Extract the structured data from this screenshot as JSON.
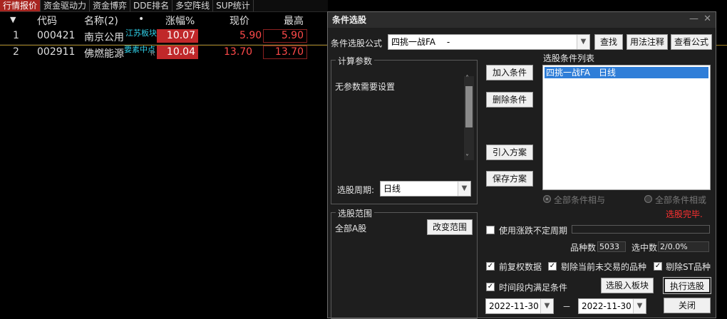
{
  "tabs": [
    "行情报价",
    "资金驱动力",
    "资金博弈",
    "DDE排名",
    "多空阵线",
    "SUP统计"
  ],
  "table": {
    "sort_arrow": "▼",
    "headers": [
      "代码",
      "名称(2)",
      "•",
      "涨幅%",
      "现价",
      "最高"
    ],
    "rows": [
      {
        "num": "1",
        "code": "000421",
        "name": "南京公用",
        "tag": "江苏板块",
        "flag": "",
        "change": "10.07",
        "price": "5.90",
        "high": "5.90"
      },
      {
        "num": "2",
        "code": "002911",
        "name": "佛燃能源",
        "tag": "要素中点",
        "flag": "R",
        "change": "10.04",
        "price": "13.70",
        "high": "13.70"
      }
    ]
  },
  "dialog": {
    "title": "条件选股",
    "formula_label": "条件选股公式",
    "formula_value": "四挑一战FA　 -",
    "find_button": "查找",
    "usage_button": "用法注释",
    "view_formula_button": "查看公式",
    "params_group": "计算参数",
    "params_text": "无参数需要设置",
    "period_label": "选股周期:",
    "period_value": "日线",
    "add_condition": "加入条件",
    "delete_condition": "删除条件",
    "import_plan": "引入方案",
    "save_plan": "保存方案",
    "condition_list_label": "选股条件列表",
    "condition_item": "四挑一战FA　日线",
    "radio_and": "全部条件相与",
    "radio_or": "全部条件相或",
    "status": "选股完毕.",
    "range_group": "选股范围",
    "range_value": "全部A股",
    "change_range": "改变范围",
    "use_uncertain_period": "使用涨跌不定周期",
    "stock_count_label": "品种数",
    "stock_count_value": "5033",
    "selected_label": "选中数",
    "selected_value": "2/0.0%",
    "opt_forward_adjust": "前复权数据",
    "opt_exclude_untraded": "剔除当前未交易的品种",
    "opt_exclude_st": "剔除ST品种",
    "opt_time_range": "时间段内满足条件",
    "to_block_button": "选股入板块",
    "execute_button": "执行选股",
    "date_from": "2022-11-30",
    "date_sep": "－",
    "date_to": "2022-11-30",
    "close_button": "关闭"
  },
  "colors": {
    "accent_red": "#c0282a",
    "price_red": "#ff4a4a",
    "tag_cyan": "#30d0e8",
    "selection_blue": "#2f7ed8"
  }
}
